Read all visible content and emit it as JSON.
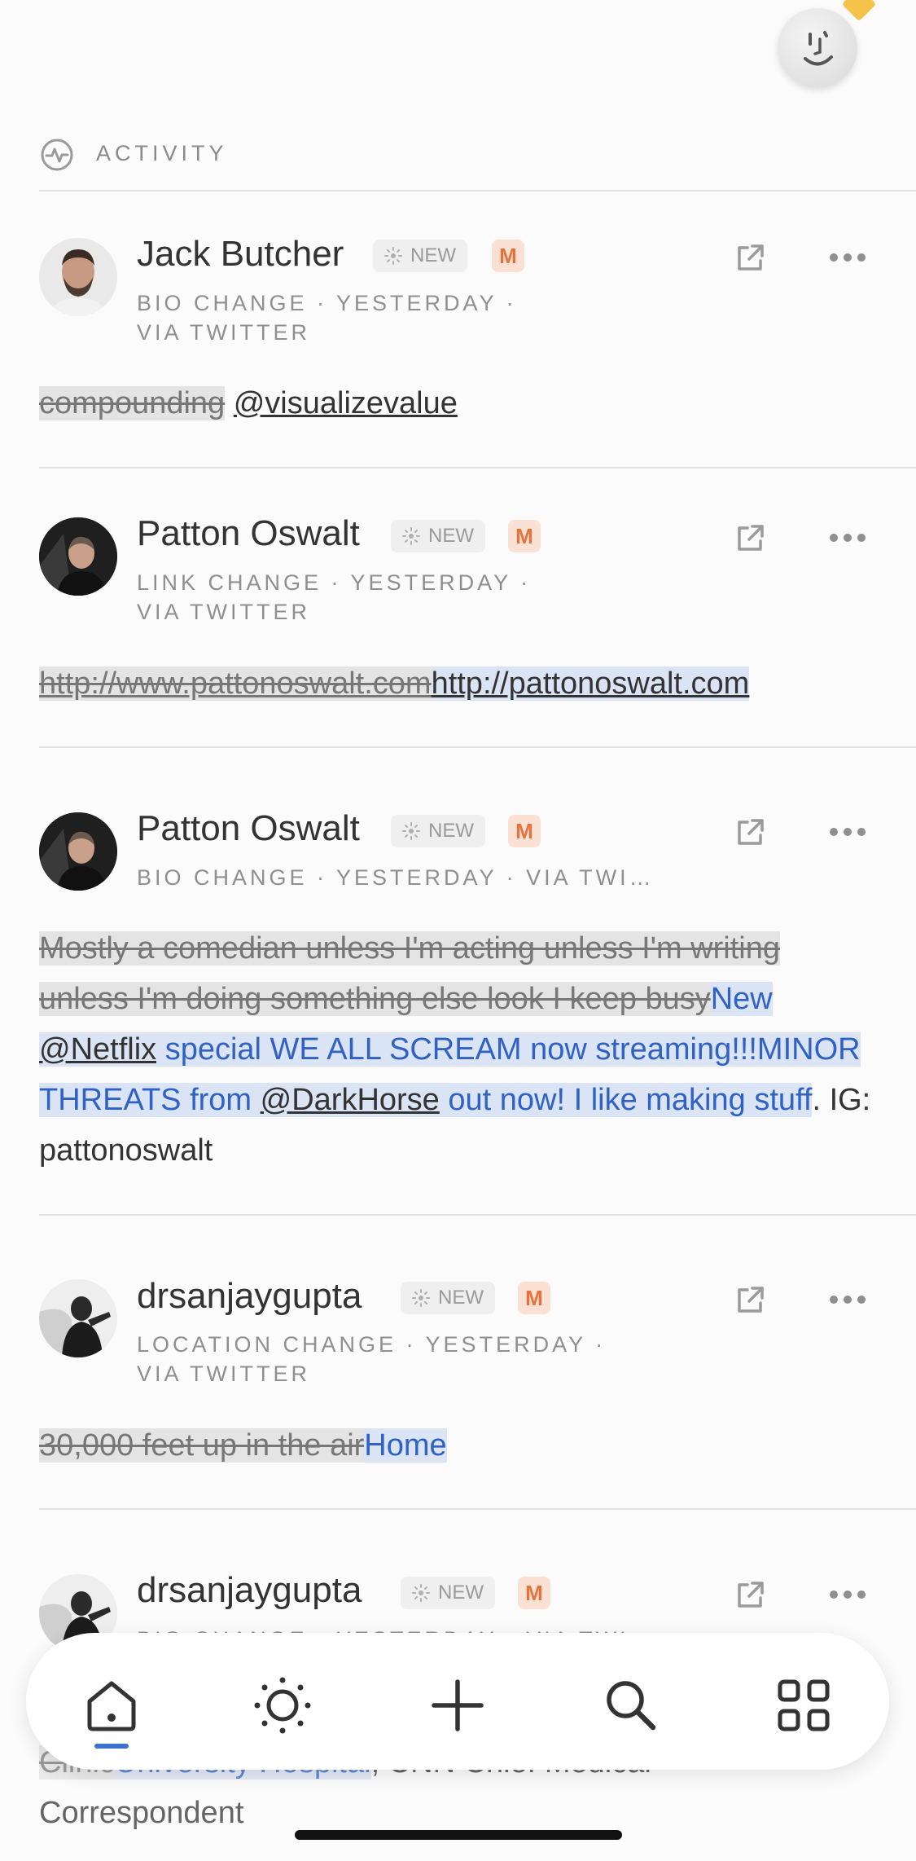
{
  "header": {
    "section_title": "ACTIVITY"
  },
  "cards": [
    {
      "name": "Jack Butcher",
      "badge_new": "NEW",
      "badge_m": "M",
      "meta_line1": "BIO CHANGE · YESTERDAY ·",
      "meta_line2": "VIA TWITTER",
      "old_text": "compounding",
      "new_text": "@visualizevalue"
    },
    {
      "name": "Patton Oswalt",
      "badge_new": "NEW",
      "badge_m": "M",
      "meta_line1": "LINK CHANGE · YESTERDAY ·",
      "meta_line2": "VIA TWITTER",
      "old_text": "http://www.pattonoswalt.com",
      "new_text": "http://pattonoswalt.com"
    },
    {
      "name": "Patton Oswalt",
      "badge_new": "NEW",
      "badge_m": "M",
      "meta_line1": "BIO CHANGE · YESTERDAY · VIA TWI…",
      "old_text": "Mostly a comedian unless I'm acting unless I'm writing unless I'm doing something else look I keep busy",
      "new_a": "New ",
      "new_mention1": "@Netflix",
      "new_b": " special WE ALL SCREAM now streaming!!!MINOR THREATS from ",
      "new_mention2": "@DarkHorse",
      "new_c": " out now! I like making stuff",
      "unchanged": ". IG: pattonoswalt"
    },
    {
      "name": "drsanjaygupta",
      "badge_new": "NEW",
      "badge_m": "M",
      "meta_line1": "LOCATION CHANGE · YESTERDAY ·",
      "meta_line2": "VIA TWITTER",
      "old_text": "30,000 feet up in the air",
      "new_text": "Home"
    },
    {
      "name": "drsanjaygupta",
      "badge_new": "NEW",
      "badge_m": "M",
      "meta_line1": "BIO CHANGE · YESTERDAY · VIA TWI…",
      "old_text": "Clinic",
      "new_text": "University Hospital",
      "unchanged_a": ", CNN Chief Medical",
      "unchanged_b": "Correspondent"
    }
  ],
  "nav": {
    "items": [
      "home-icon",
      "sun-icon",
      "plus-icon",
      "search-icon",
      "grid-icon"
    ],
    "active": "home-icon"
  },
  "colors": {
    "accent": "#3d6fd0",
    "deleted_bg": "#e4e4e4",
    "inserted_bg": "#dbe4f4",
    "inserted_text": "#2f62c4",
    "m_badge_bg": "#fbe0d4",
    "m_badge_text": "#e8723b"
  }
}
